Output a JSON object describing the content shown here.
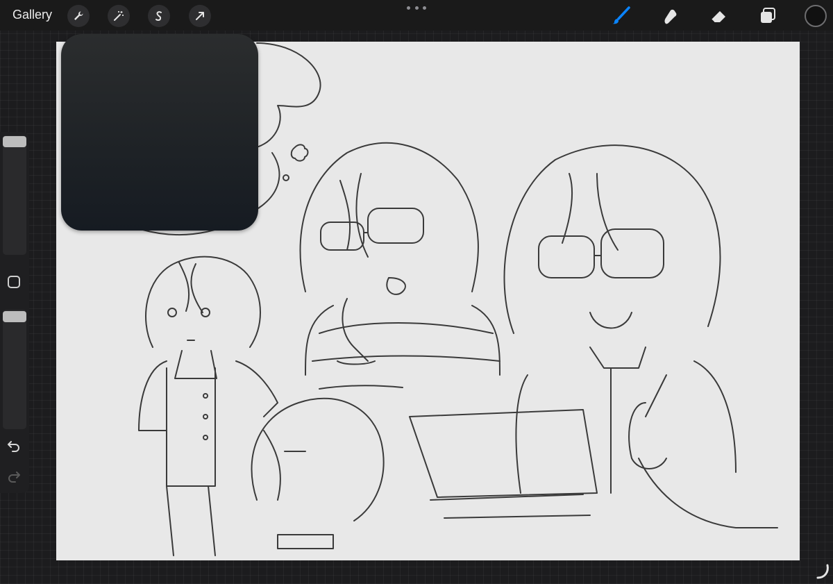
{
  "topbar": {
    "gallery_label": "Gallery",
    "tools": [
      {
        "icon": "wrench-icon"
      },
      {
        "icon": "magic-wand-icon"
      },
      {
        "icon": "selection-icon"
      },
      {
        "icon": "transform-arrow-icon"
      }
    ],
    "right_tools": [
      {
        "icon": "brush-icon",
        "active": true
      },
      {
        "icon": "smudge-icon",
        "active": false
      },
      {
        "icon": "eraser-icon",
        "active": false
      },
      {
        "icon": "layers-icon",
        "active": false
      }
    ],
    "current_color": "#111111"
  },
  "sidebar": {
    "brush_size_level": 0.0,
    "opacity_level": 0.0,
    "undo_icon": "undo-icon",
    "redo_icon": "redo-icon"
  },
  "colors": {
    "active_tool": "#0a84ff",
    "toolbar_bg": "#1a1a1a",
    "canvas_bg": "#e8e8e8",
    "sketch_stroke": "#3a3a3a"
  }
}
